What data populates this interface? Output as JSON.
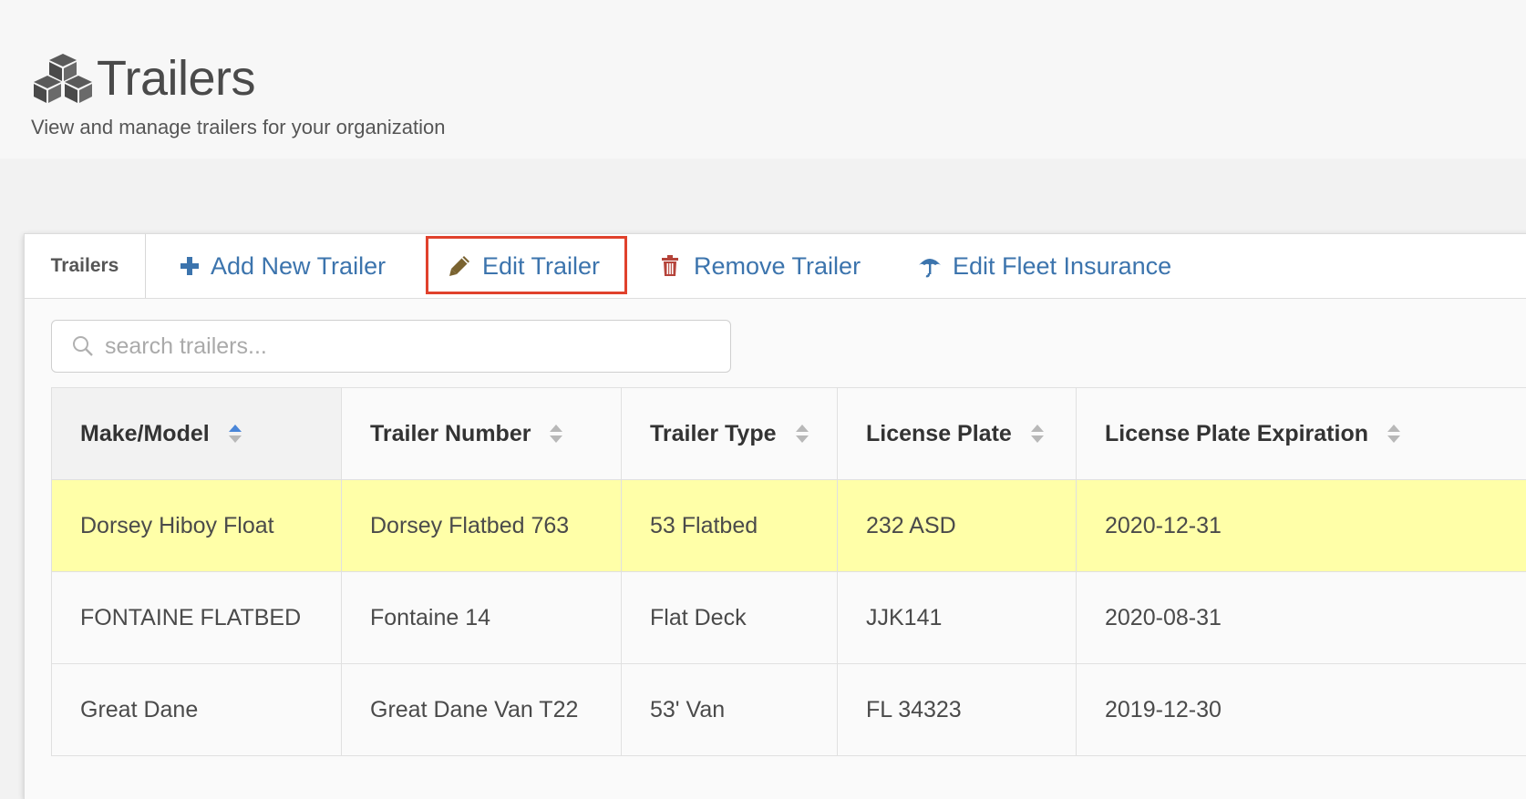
{
  "header": {
    "title": "Trailers",
    "subtitle": "View and manage trailers for your organization",
    "icon": "cubes-icon"
  },
  "toolbar": {
    "tab_label": "Trailers",
    "add_label": "Add New Trailer",
    "edit_label": "Edit Trailer",
    "remove_label": "Remove Trailer",
    "insurance_label": "Edit Fleet Insurance",
    "accent_color": "#3c74ad",
    "remove_icon_color": "#b5433a",
    "edit_icon_color": "#7a6330",
    "highlight_color": "#e0412c"
  },
  "search": {
    "placeholder": "search trailers...",
    "value": ""
  },
  "table": {
    "columns": [
      {
        "label": "Make/Model",
        "sorted": true
      },
      {
        "label": "Trailer Number",
        "sorted": false
      },
      {
        "label": "Trailer Type",
        "sorted": false
      },
      {
        "label": "License Plate",
        "sorted": false
      },
      {
        "label": "License Plate Expiration",
        "sorted": false
      }
    ],
    "rows": [
      {
        "make_model": "Dorsey Hiboy Float",
        "trailer_number": "Dorsey Flatbed 763",
        "trailer_type": "53 Flatbed",
        "license_plate": "232 ASD",
        "expiration": "2020-12-31",
        "selected": true
      },
      {
        "make_model": "FONTAINE FLATBED",
        "trailer_number": "Fontaine 14",
        "trailer_type": "Flat Deck",
        "license_plate": "JJK141",
        "expiration": "2020-08-31",
        "selected": false
      },
      {
        "make_model": "Great Dane",
        "trailer_number": "Great Dane Van T22",
        "trailer_type": "53' Van",
        "license_plate": "FL 34323",
        "expiration": "2019-12-30",
        "selected": false
      }
    ],
    "selected_row_color": "#ffffa8"
  }
}
